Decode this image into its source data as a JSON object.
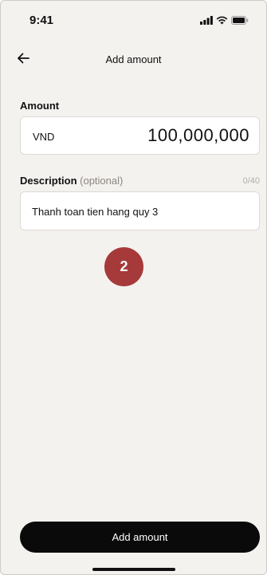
{
  "status_bar": {
    "time": "9:41",
    "icons": [
      "signal-icon",
      "wifi-icon",
      "battery-icon"
    ]
  },
  "header": {
    "back_icon": "arrow-left-icon",
    "title": "Add amount"
  },
  "amount": {
    "label": "Amount",
    "currency": "VND",
    "value": "100,000,000"
  },
  "description": {
    "label": "Description",
    "optional_label": "(optional)",
    "char_count": "0/40",
    "value": "Thanh toan tien hang quy 3"
  },
  "step_badge": {
    "number": "2",
    "color": "#a63a3a"
  },
  "footer": {
    "button_label": "Add amount"
  },
  "colors": {
    "background": "#f4f2ef",
    "primary_button": "#0a0a0a",
    "field_background": "#ffffff"
  }
}
